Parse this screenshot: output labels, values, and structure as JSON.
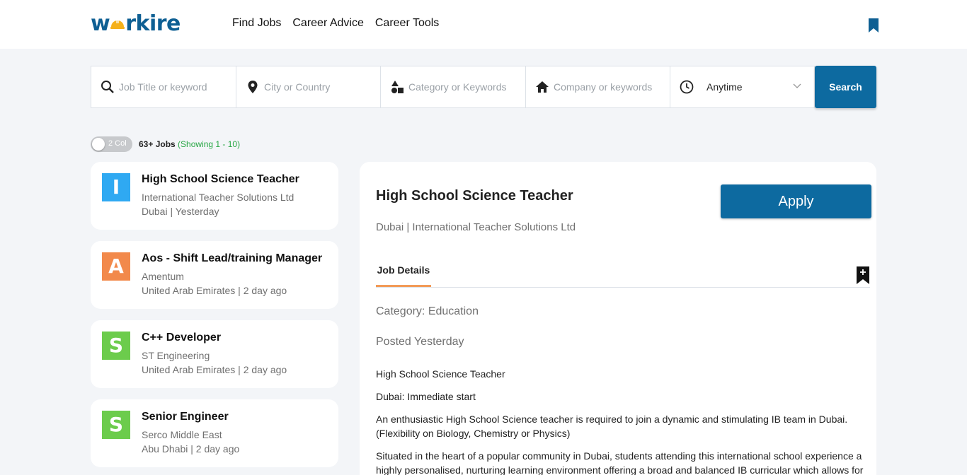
{
  "header": {
    "logo_text_1": "w",
    "logo_text_2": "rkire",
    "nav": [
      "Find Jobs",
      "Career Advice",
      "Career Tools"
    ],
    "brand_color": "#0e5f93",
    "logo_accent": "#f5b11a"
  },
  "search": {
    "job_placeholder": "Job Title or keyword",
    "city_placeholder": "City or Country",
    "category_placeholder": "Category or Keywords",
    "company_placeholder": "Company or keywords",
    "time_value": "Anytime",
    "button_label": "Search"
  },
  "toolbar": {
    "toggle_label": "2 Col",
    "jobs_count": "63+ Jobs",
    "showing": "(Showing 1 - 10)"
  },
  "jobs": [
    {
      "letter": "I",
      "color": "#2fa9f2",
      "title": "High School Science Teacher",
      "company": "International Teacher Solutions Ltd",
      "meta": "Dubai | Yesterday"
    },
    {
      "letter": "A",
      "color": "#f2894b",
      "title": "Aos - Shift Lead/training Manager",
      "company": "Amentum",
      "meta": "United Arab Emirates | 2 day ago"
    },
    {
      "letter": "S",
      "color": "#6ccc4c",
      "title": "C++ Developer",
      "company": "ST Engineering",
      "meta": "United Arab Emirates | 2 day ago"
    },
    {
      "letter": "S",
      "color": "#6ccc4c",
      "title": "Senior Engineer",
      "company": "Serco Middle East",
      "meta": "Abu Dhabi | 2 day ago"
    }
  ],
  "detail": {
    "title": "High School Science Teacher",
    "subtitle": "Dubai | International Teacher Solutions Ltd",
    "apply_label": "Apply",
    "tab_label": "Job Details",
    "category": "Category: Education",
    "posted": "Posted Yesterday",
    "body": [
      "High School Science Teacher",
      "Dubai: Immediate start",
      "An enthusiastic High School Science teacher is required to join a dynamic and stimulating IB team in Dubai. (Flexibility on Biology, Chemistry or Physics)",
      "Situated in the heart of a popular community in Dubai, students attending this international school experience a highly personalised, nurturing learning environment offering a broad and balanced IB curricular which allows for"
    ]
  }
}
